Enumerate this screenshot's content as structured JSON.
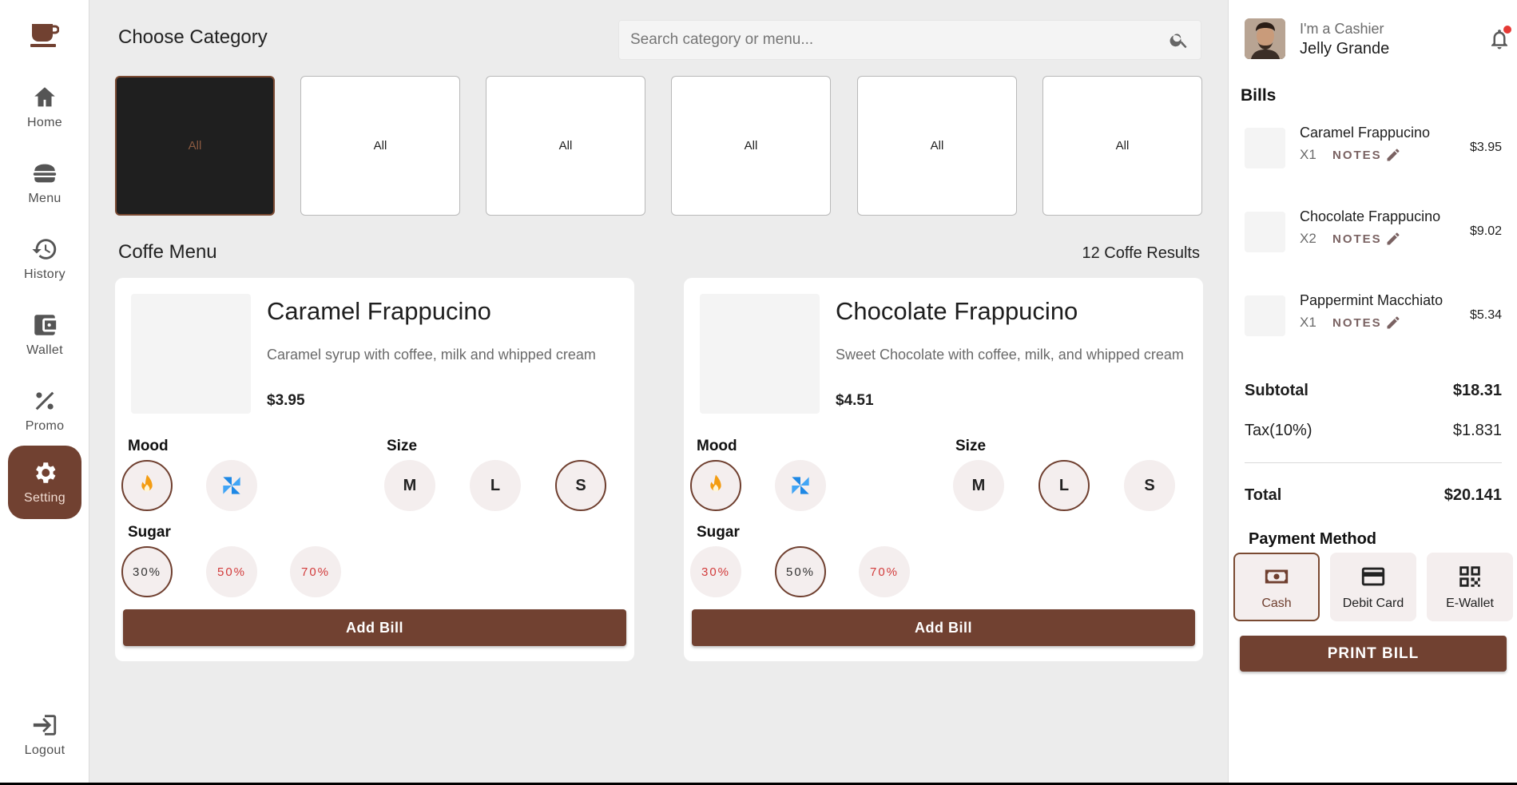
{
  "sidebar": {
    "logo_icon": "coffee-cup-icon",
    "items": [
      {
        "label": "Home",
        "icon": "home-icon"
      },
      {
        "label": "Menu",
        "icon": "burger-icon"
      },
      {
        "label": "History",
        "icon": "history-icon"
      },
      {
        "label": "Wallet",
        "icon": "wallet-icon"
      },
      {
        "label": "Promo",
        "icon": "percent-icon"
      },
      {
        "label": "Setting",
        "icon": "gear-icon",
        "active": true
      }
    ],
    "logout_label": "Logout"
  },
  "header": {
    "category_title": "Choose Category",
    "search_placeholder": "Search category or menu..."
  },
  "categories": [
    "All",
    "All",
    "All",
    "All",
    "All",
    "All"
  ],
  "menu": {
    "title": "Coffe Menu",
    "results": "12 Coffe Results",
    "labels": {
      "mood": "Mood",
      "size": "Size",
      "sugar": "Sugar",
      "add": "Add Bill"
    },
    "products": [
      {
        "name": "Caramel Frappucino",
        "description": "Caramel syrup with coffee, milk and whipped cream",
        "price": "$3.95",
        "sizes": [
          "M",
          "L",
          "S"
        ],
        "selected_size": "S",
        "sugar": [
          "30%",
          "50%",
          "70%"
        ],
        "selected_sugar": "30%",
        "selected_mood": "hot"
      },
      {
        "name": "Chocolate Frappucino",
        "description": "Sweet Chocolate with coffee, milk, and whipped cream",
        "price": "$4.51",
        "sizes": [
          "M",
          "L",
          "S"
        ],
        "selected_size": "L",
        "sugar": [
          "30%",
          "50%",
          "70%"
        ],
        "selected_sugar": "50%",
        "selected_mood": "hot"
      }
    ]
  },
  "user": {
    "role": "I'm a Cashier",
    "name": "Jelly Grande"
  },
  "bills": {
    "title": "Bills",
    "items": [
      {
        "name": "Caramel Frappucino",
        "qty": "X1",
        "notes": "NOTES",
        "price": "$3.95"
      },
      {
        "name": "Chocolate Frappucino",
        "qty": "X2",
        "notes": "NOTES",
        "price": "$9.02"
      },
      {
        "name": "Pappermint Macchiato",
        "qty": "X1",
        "notes": "NOTES",
        "price": "$5.34"
      }
    ],
    "subtotal_label": "Subtotal",
    "subtotal": "$18.31",
    "tax_label": "Tax(10%)",
    "tax": "$1.831",
    "total_label": "Total",
    "total": "$20.141"
  },
  "payment": {
    "title": "Payment Method",
    "methods": [
      {
        "label": "Cash",
        "icon": "cash-icon",
        "selected": true
      },
      {
        "label": "Debit Card",
        "icon": "credit-card-icon"
      },
      {
        "label": "E-Wallet",
        "icon": "qr-code-icon"
      }
    ],
    "print_label": "PRINT BILL"
  },
  "colors": {
    "accent": "#714131",
    "background": "#ececec",
    "notification": "#e53935"
  }
}
